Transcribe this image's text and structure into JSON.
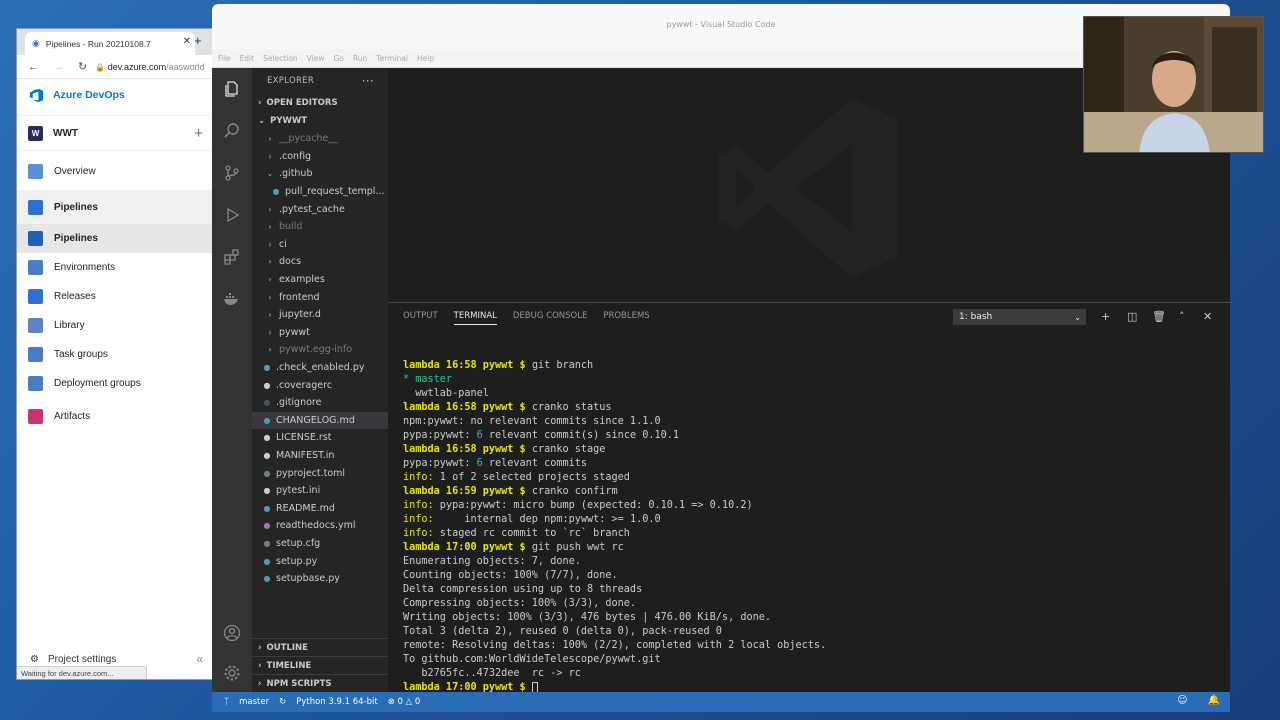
{
  "browser": {
    "tab_title": "Pipelines - Run 20210108.7",
    "url_host": "dev.azure.com",
    "url_path": "/aasworld",
    "status_text": "Waiting for dev.azure.com..."
  },
  "ado": {
    "brand": "Azure DevOps",
    "project_initial": "W",
    "project_name": "WWT",
    "nav": [
      {
        "label": "Overview",
        "color": "#5a8fd8"
      },
      {
        "label": "Pipelines",
        "color": "#2f6fd0"
      },
      {
        "label": "Pipelines",
        "color": "#1f5fb8"
      },
      {
        "label": "Environments",
        "color": "#4a7dc6"
      },
      {
        "label": "Releases",
        "color": "#2f6fd0"
      },
      {
        "label": "Library",
        "color": "#5b84c4"
      },
      {
        "label": "Task groups",
        "color": "#4a7dc6"
      },
      {
        "label": "Deployment groups",
        "color": "#4a7dc6"
      },
      {
        "label": "Artifacts",
        "color": "#c8336f"
      }
    ],
    "settings_label": "Project settings"
  },
  "vscode": {
    "title": "pywwt - Visual Studio Code",
    "menu": [
      "File",
      "Edit",
      "Selection",
      "View",
      "Go",
      "Run",
      "Terminal",
      "Help"
    ],
    "explorer_title": "EXPLORER",
    "open_editors": "OPEN EDITORS",
    "folder": "PYWWT",
    "tree": [
      {
        "name": "__pycache__",
        "type": "folder",
        "dim": true
      },
      {
        "name": ".config",
        "type": "folder"
      },
      {
        "name": ".github",
        "type": "folder-open"
      },
      {
        "name": "pull_request_templ...",
        "type": "file",
        "indent": true,
        "icon_color": "#519aba"
      },
      {
        "name": ".pytest_cache",
        "type": "folder"
      },
      {
        "name": "build",
        "type": "folder",
        "dim": true
      },
      {
        "name": "ci",
        "type": "folder"
      },
      {
        "name": "docs",
        "type": "folder"
      },
      {
        "name": "examples",
        "type": "folder"
      },
      {
        "name": "frontend",
        "type": "folder"
      },
      {
        "name": "jupyter.d",
        "type": "folder"
      },
      {
        "name": "pywwt",
        "type": "folder"
      },
      {
        "name": "pywwt.egg-info",
        "type": "folder",
        "dim": true
      },
      {
        "name": ".check_enabled.py",
        "type": "file",
        "icon_color": "#519aba"
      },
      {
        "name": ".coveragerc",
        "type": "file",
        "icon_color": "#cccccc"
      },
      {
        "name": ".gitignore",
        "type": "file",
        "icon_color": "#41535b"
      },
      {
        "name": "CHANGELOG.md",
        "type": "file",
        "icon_color": "#519aba",
        "selected": true
      },
      {
        "name": "LICENSE.rst",
        "type": "file",
        "icon_color": "#cccccc"
      },
      {
        "name": "MANIFEST.in",
        "type": "file",
        "icon_color": "#cccccc"
      },
      {
        "name": "pyproject.toml",
        "type": "file",
        "icon_color": "#6d8086"
      },
      {
        "name": "pytest.ini",
        "type": "file",
        "icon_color": "#cccccc"
      },
      {
        "name": "README.md",
        "type": "file",
        "icon_color": "#519aba"
      },
      {
        "name": "readthedocs.yml",
        "type": "file",
        "icon_color": "#a074c4"
      },
      {
        "name": "setup.cfg",
        "type": "file",
        "icon_color": "#6d8086"
      },
      {
        "name": "setup.py",
        "type": "file",
        "icon_color": "#519aba"
      },
      {
        "name": "setupbase.py",
        "type": "file",
        "icon_color": "#519aba"
      }
    ],
    "bottom_sections": [
      "OUTLINE",
      "TIMELINE",
      "NPM SCRIPTS"
    ],
    "panel_tabs": [
      "OUTPUT",
      "TERMINAL",
      "DEBUG CONSOLE",
      "PROBLEMS"
    ],
    "active_panel_tab": "TERMINAL",
    "shell": "1: bash",
    "terminal_lines": [
      {
        "cls": "cmd",
        "prompt": "lambda 16:58 pywwt $ ",
        "text": "git branch"
      },
      {
        "cls": "grn",
        "text": "* master"
      },
      {
        "cls": "plain",
        "text": "  wwtlab-panel"
      },
      {
        "cls": "cmd",
        "prompt": "lambda 16:58 pywwt $ ",
        "text": "cranko status"
      },
      {
        "cls": "plain",
        "text": "npm:pywwt: no relevant commits since 1.1.0"
      },
      {
        "cls": "plain",
        "text": "pypa:pywwt: 6 relevant commit(s) since 0.10.1"
      },
      {
        "cls": "cmd",
        "prompt": "lambda 16:58 pywwt $ ",
        "text": "cranko stage"
      },
      {
        "cls": "plain",
        "text": "pypa:pywwt: 6 relevant commits"
      },
      {
        "cls": "info",
        "label": "info:",
        "text": " 1 of 2 selected projects staged"
      },
      {
        "cls": "cmd",
        "prompt": "lambda 16:59 pywwt $ ",
        "text": "cranko confirm"
      },
      {
        "cls": "info",
        "label": "info:",
        "text": " pypa:pywwt: micro bump (expected: 0.10.1 => 0.10.2)"
      },
      {
        "cls": "info",
        "label": "info:",
        "text": "     internal dep npm:pywwt: >= 1.0.0"
      },
      {
        "cls": "info",
        "label": "info:",
        "text": " staged rc commit to `rc` branch"
      },
      {
        "cls": "cmd",
        "prompt": "lambda 17:00 pywwt $ ",
        "text": "git push wwt rc"
      },
      {
        "cls": "plain",
        "text": "Enumerating objects: 7, done."
      },
      {
        "cls": "plain",
        "text": "Counting objects: 100% (7/7), done."
      },
      {
        "cls": "plain",
        "text": "Delta compression using up to 8 threads"
      },
      {
        "cls": "plain",
        "text": "Compressing objects: 100% (3/3), done."
      },
      {
        "cls": "plain",
        "text": "Writing objects: 100% (3/3), 476 bytes | 476.00 KiB/s, done."
      },
      {
        "cls": "plain",
        "text": "Total 3 (delta 2), reused 0 (delta 0), pack-reused 0"
      },
      {
        "cls": "plain",
        "text": "remote: Resolving deltas: 100% (2/2), completed with 2 local objects."
      },
      {
        "cls": "plain",
        "text": "To github.com:WorldWideTelescope/pywwt.git"
      },
      {
        "cls": "plain",
        "text": "   b2765fc..4732dee  rc -> rc"
      },
      {
        "cls": "cmd",
        "prompt": "lambda 17:00 pywwt $ ",
        "text": "",
        "cursor": true
      }
    ],
    "status": {
      "branch": "master",
      "python": "Python 3.9.1 64-bit",
      "errors": "0",
      "warnings": "0"
    }
  }
}
